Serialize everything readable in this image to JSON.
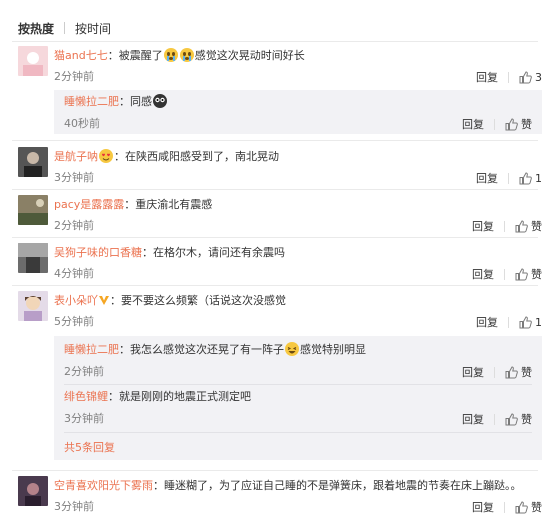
{
  "sort_tabs": [
    {
      "label": "按热度",
      "active": true
    },
    {
      "label": "按时间",
      "active": false
    }
  ],
  "actions": {
    "reply": "回复",
    "like": "赞"
  },
  "comments": [
    {
      "user": "猫and七七",
      "text": "：被震醒了",
      "text2": "感觉这次晃动时间好长",
      "time": "2分钟前",
      "likes": "3"
    },
    {
      "user": "睡懒拉二肥",
      "text": "：同感",
      "time": "40秒前",
      "likes": ""
    },
    {
      "user": "是航子呐",
      "text": "：在陕西咸阳感受到了，南北晃动",
      "time": "3分钟前",
      "likes": "1"
    },
    {
      "user": "pacy是露露露",
      "text": "：重庆渝北有震感",
      "time": "2分钟前",
      "likes": ""
    },
    {
      "user": "吴狗子味的口香糖",
      "text": "：在格尔木，请问还有余震吗",
      "time": "4分钟前",
      "likes": ""
    },
    {
      "user": "表小朵吖",
      "text": "：要不要这么频繁（话说这次没感觉",
      "time": "5分钟前",
      "likes": "1"
    },
    {
      "user": "睡懒拉二肥",
      "text": "：我怎么感觉这次还晃了有一阵子",
      "text2": "感觉特别明显",
      "time": "2分钟前",
      "likes": ""
    },
    {
      "user": "绯色锦鲤",
      "text": "：就是刚刚的地震正式测定吧",
      "time": "3分钟前",
      "likes": ""
    },
    {
      "user": "空青喜欢阳光下雾雨",
      "text": "：睡迷糊了，为了应证自己睡的不是弹簧床，跟着地震的节奏在床上蹦跶。。",
      "time": "3分钟前",
      "likes": ""
    }
  ],
  "more_replies": "共5条回复",
  "icons": [
    "thumbs-up-icon",
    "crying-emoji-icon",
    "vip-v-icon"
  ],
  "colors": {
    "username": "#eb7350",
    "reply_bg": "#f2f2f5",
    "time": "#808080"
  }
}
